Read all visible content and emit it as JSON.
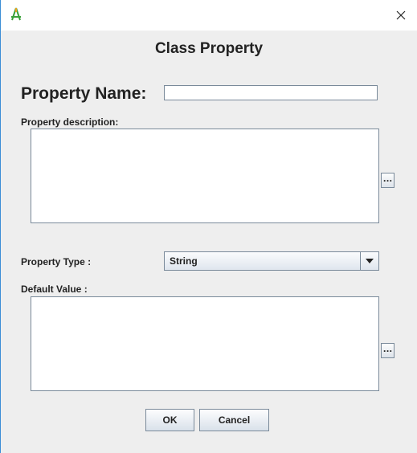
{
  "window": {
    "close_glyph": "×"
  },
  "dialog": {
    "title": "Class  Property"
  },
  "property_name": {
    "label": "Property Name:",
    "value": ""
  },
  "property_description": {
    "label": "Property description:",
    "value": "",
    "browse_label": "..."
  },
  "property_type": {
    "label": "Property Type :",
    "selected": "String"
  },
  "default_value": {
    "label": "Default Value :",
    "value": "",
    "browse_label": "..."
  },
  "buttons": {
    "ok": "OK",
    "cancel": "Cancel"
  },
  "icons": {
    "app": "app-logo-icon",
    "close": "close-icon",
    "dropdown": "chevron-down-icon"
  },
  "colors": {
    "window_border": "#3c8ed6",
    "background": "#eeeeee",
    "app_icon": "#3aa13a"
  }
}
